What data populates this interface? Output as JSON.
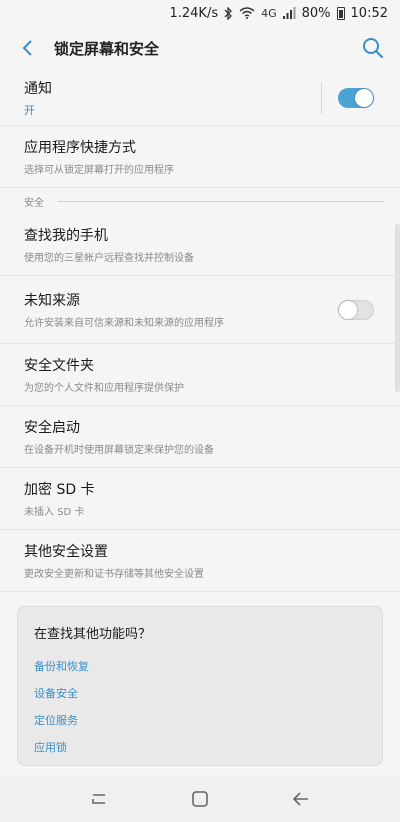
{
  "status_bar": {
    "speed": "1.24K/s",
    "network_label": "4G",
    "battery": "80%",
    "time": "10:52",
    "icons": [
      "bluetooth-icon",
      "wifi-icon",
      "signal-icon",
      "battery-icon"
    ]
  },
  "app_bar": {
    "title": "锁定屏幕和安全",
    "back_icon": "back-arrow-icon",
    "search_icon": "search-icon"
  },
  "colors": {
    "accent": "#3a8fc7",
    "toggle_on": "#4aa3d4"
  },
  "items": [
    {
      "title": "通知",
      "subtitle": "开",
      "toggle": true
    },
    {
      "title": "应用程序快捷方式",
      "subtitle": "选择可从锁定屏幕打开的应用程序"
    },
    {
      "title": "查找我的手机",
      "subtitle": "使用您的三星帐户远程查找并控制设备"
    },
    {
      "title": "未知来源",
      "subtitle": "允许安装来自可信来源和未知来源的应用程序",
      "toggle": false
    },
    {
      "title": "安全文件夹",
      "subtitle": "为您的个人文件和应用程序提供保护"
    },
    {
      "title": "安全启动",
      "subtitle": "在设备开机时使用屏幕锁定来保护您的设备"
    },
    {
      "title": "加密 SD 卡",
      "subtitle": "未插入 SD 卡"
    },
    {
      "title": "其他安全设置",
      "subtitle": "更改安全更新和证书存储等其他安全设置"
    }
  ],
  "section_label": "安全",
  "card": {
    "title": "在查找其他功能吗？",
    "links": [
      "备份和恢复",
      "设备安全",
      "定位服务",
      "应用锁"
    ]
  },
  "nav_bar": {
    "icons": [
      "recents-icon",
      "home-icon",
      "back-icon"
    ]
  }
}
